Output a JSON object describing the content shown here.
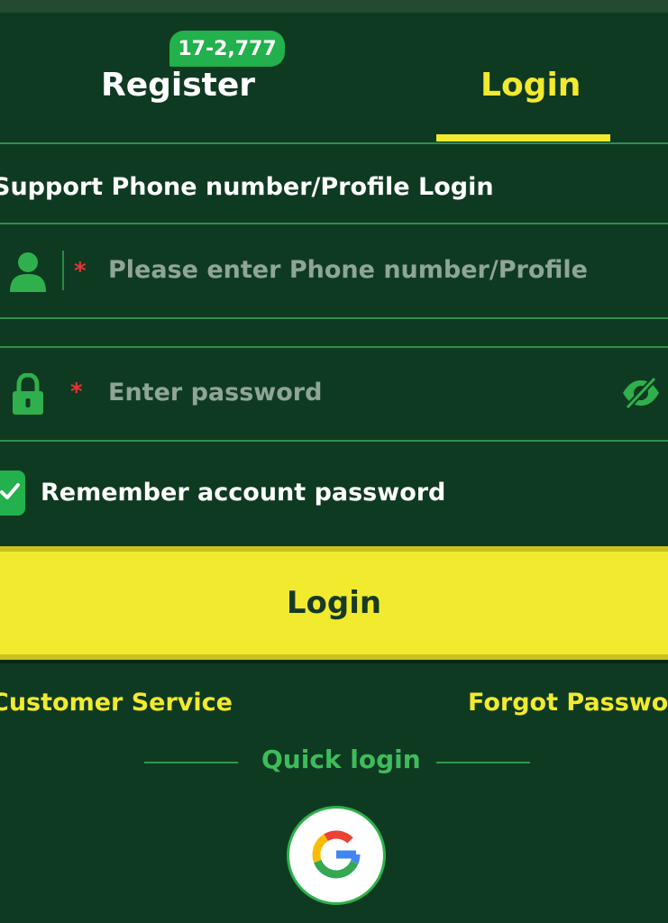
{
  "tabs": {
    "register_label": "Register",
    "register_badge": "17-2,777",
    "login_label": "Login"
  },
  "form": {
    "section_title": "Support Phone number/Profile Login",
    "required_mark": "*",
    "phone_placeholder": "Please enter Phone number/Profile",
    "phone_value": "",
    "password_placeholder": "Enter password",
    "password_value": "",
    "remember_label": "Remember account password",
    "remember_checked": true,
    "login_button": "Login"
  },
  "links": {
    "customer_service": "Customer Service",
    "forgot_password": "Forgot Password"
  },
  "quick_login": {
    "label": "Quick login",
    "providers": [
      "google-icon"
    ]
  },
  "icons": {
    "phone_field": "user-icon",
    "password_field": "lock-icon",
    "password_toggle": "eye-off-icon",
    "remember_check": "checkmark-icon"
  },
  "colors": {
    "background": "#0f3a22",
    "accent_yellow": "#f2ea2e",
    "accent_green": "#22b14c",
    "divider_green": "#2f8f4a",
    "required_red": "#e63333"
  }
}
